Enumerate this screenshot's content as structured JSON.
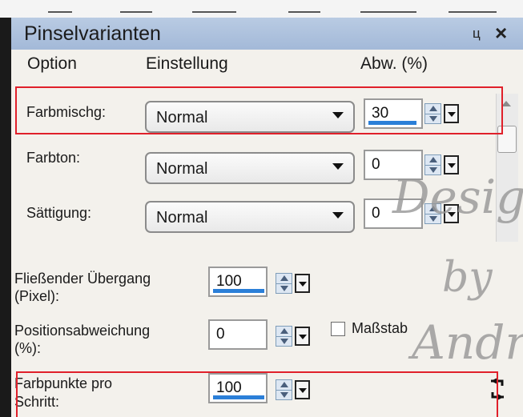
{
  "panel": {
    "title": "Pinselvarianten",
    "pin_glyph": "ц",
    "close_glyph": "×"
  },
  "columns": {
    "option": "Option",
    "einstellung": "Einstellung",
    "abw": "Abw. (%)"
  },
  "rows": [
    {
      "label": "Farbmischg:",
      "setting": "Normal",
      "deviation": "30"
    },
    {
      "label": "Farbton:",
      "setting": "Normal",
      "deviation": "0"
    },
    {
      "label": "Sättigung:",
      "setting": "Normal",
      "deviation": "0"
    }
  ],
  "settings": {
    "fliessender_uebergang": {
      "label_line1": "Fließender Übergang",
      "label_line2": "(Pixel):",
      "value": "100"
    },
    "positionsabweichung": {
      "label_line1": "Positionsabweichung",
      "label_line2": "(%):",
      "value": "0"
    },
    "massstab": {
      "label": "Maßstab",
      "checked": false
    },
    "farbpunkte": {
      "label_line1": "Farbpunkte pro",
      "label_line2": "Schritt:",
      "value": "100"
    }
  },
  "watermark": {
    "line1": "Design",
    "line2": "by",
    "line3": "Andrea"
  },
  "colors": {
    "title_bar": "#a3b9d8",
    "highlight": "#e0202a",
    "field_underline": "#2b7fd8"
  }
}
